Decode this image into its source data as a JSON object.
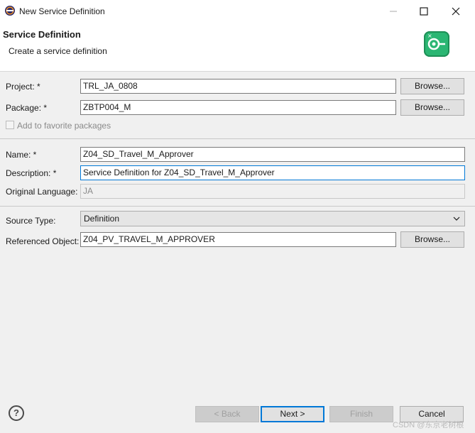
{
  "window": {
    "title": "New Service Definition",
    "minimize_icon": "minimize-icon",
    "maximize_icon": "maximize-icon",
    "close_icon": "close-icon"
  },
  "header": {
    "title": "Service Definition",
    "subtitle": "Create a service definition",
    "icon": "service-definition-wizard-icon"
  },
  "form": {
    "project": {
      "label": "Project: *",
      "value": "TRL_JA_0808",
      "browse": "Browse..."
    },
    "package": {
      "label": "Package: *",
      "value": "ZBTP004_M",
      "browse": "Browse..."
    },
    "favorite": {
      "label": "Add to favorite packages",
      "checked": false
    },
    "name": {
      "label": "Name: *",
      "value": "Z04_SD_Travel_M_Approver"
    },
    "description": {
      "label": "Description: *",
      "value": "Service Definition for Z04_SD_Travel_M_Approver"
    },
    "original_language": {
      "label": "Original Language:",
      "value": "JA"
    },
    "source_type": {
      "label": "Source Type:",
      "value": "Definition"
    },
    "referenced_object": {
      "label": "Referenced Object:",
      "value": "Z04_PV_TRAVEL_M_APPROVER",
      "browse": "Browse..."
    }
  },
  "footer": {
    "help_icon": "help-icon",
    "back": "< Back",
    "next": "Next >",
    "finish": "Finish",
    "cancel": "Cancel"
  },
  "watermark": "CSDN @东京老树根",
  "colors": {
    "accent": "#0078d7",
    "wizard_icon": "#2bb673"
  }
}
